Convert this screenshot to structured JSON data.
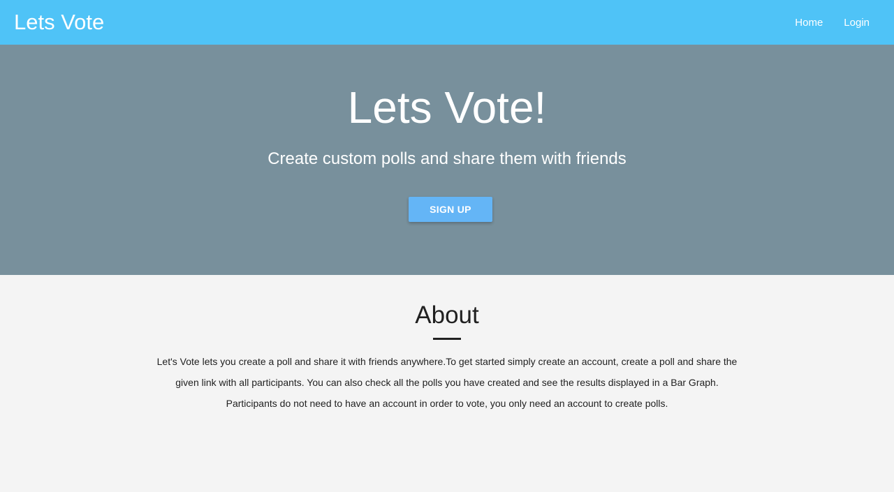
{
  "nav": {
    "brand": "Lets Vote",
    "links": [
      "Home",
      "Login"
    ]
  },
  "hero": {
    "title": "Lets Vote!",
    "subtitle": "Create custom polls and share them with friends",
    "cta": "SIGN UP"
  },
  "about": {
    "heading": "About",
    "lines": [
      "Let's Vote lets you create a poll and share it with friends anywhere.To get started simply create an account, create a poll and share the",
      "given link with all participants. You can also check all the polls you have created and see the results displayed in a Bar Graph.",
      "Participants do not need to have an account in order to vote, you only need an account to create polls."
    ]
  }
}
